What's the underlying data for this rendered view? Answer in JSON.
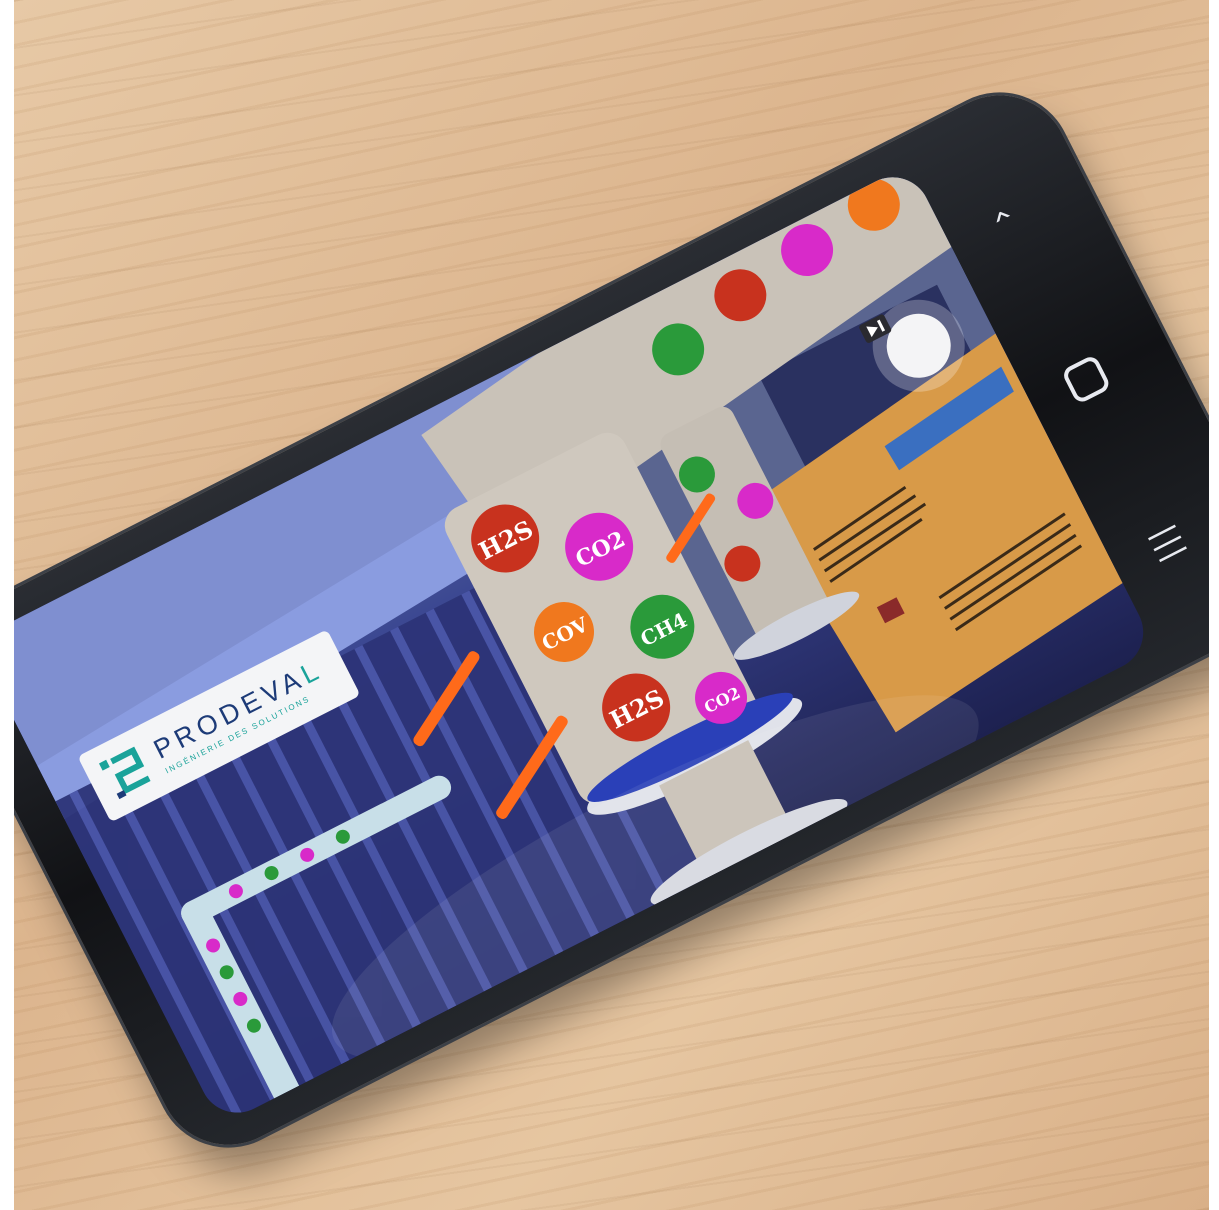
{
  "logo": {
    "name_main": "PRODEVA",
    "name_accent": "L",
    "tagline": "INGÉNIERIE DES SOLUTIONS"
  },
  "pipe_labels": [
    "H2S",
    "CO2",
    "COV",
    "CH4"
  ],
  "nav": {
    "back_icon": "chevron-left-icon",
    "home_icon": "home-rounded-square-icon",
    "recent_icon": "recent-apps-icon"
  },
  "floating_button_icon": "screen-recorder-icon",
  "colors": {
    "h2s": "#c8321e",
    "co2": "#d82ac9",
    "cov": "#f0781e",
    "ch4": "#2a9a3a",
    "valve": "#ff6a1a",
    "panel": "#d8a050"
  }
}
